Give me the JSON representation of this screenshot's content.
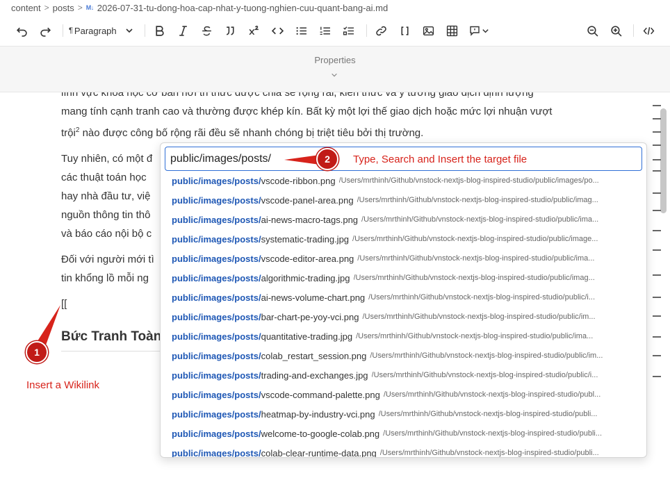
{
  "breadcrumb": {
    "items": [
      "content",
      "posts"
    ],
    "md_badge": "M↓",
    "file": "2026-07-31-tu-dong-hoa-cap-nhat-y-tuong-nghien-cuu-quant-bang-ai.md"
  },
  "toolbar": {
    "paragraph_label": "Paragraph"
  },
  "properties": {
    "label": "Properties"
  },
  "document": {
    "para1_l1": "lĩnh vực khoa học cơ bản nơi tri thức được chia sẻ rộng rãi, kiến thức và ý tưởng giao dịch định lượng",
    "para1_l2": "mang tính cạnh tranh cao và thường được khép kín. Bất kỳ một lợi thế giao dịch hoặc mức lợi nhuận vượt",
    "para1_l3a": "trội",
    "para1_sup": "2",
    "para1_l3b": " nào được công bố rộng rãi đều sẽ nhanh chóng bị triệt tiêu bởi thị trường.",
    "para2_l1": "Tuy nhiên, có một đ",
    "para2_l2": "các thuật toán học",
    "para2_l3": "hay nhà đầu tư, việ",
    "para2_l4": "nguồn thông tin thô",
    "para2_l5": "và báo cáo nội bộ c",
    "para3_l1": "Đối với người mới tì",
    "para3_l2": "tin khổng lồ mỗi ng",
    "wikilink": "[[",
    "heading": "Bức Tranh Toàn"
  },
  "popup": {
    "search_value": "public/images/posts/",
    "query": "public/images/posts/",
    "results": [
      {
        "file": "vscode-ribbon.png",
        "path": "/Users/mrthinh/Github/vnstock-nextjs-blog-inspired-studio/public/images/po..."
      },
      {
        "file": "vscode-panel-area.png",
        "path": "/Users/mrthinh/Github/vnstock-nextjs-blog-inspired-studio/public/imag..."
      },
      {
        "file": "ai-news-macro-tags.png",
        "path": "/Users/mrthinh/Github/vnstock-nextjs-blog-inspired-studio/public/ima..."
      },
      {
        "file": "systematic-trading.jpg",
        "path": "/Users/mrthinh/Github/vnstock-nextjs-blog-inspired-studio/public/image..."
      },
      {
        "file": "vscode-editor-area.png",
        "path": "/Users/mrthinh/Github/vnstock-nextjs-blog-inspired-studio/public/ima..."
      },
      {
        "file": "algorithmic-trading.jpg",
        "path": "/Users/mrthinh/Github/vnstock-nextjs-blog-inspired-studio/public/imag..."
      },
      {
        "file": "ai-news-volume-chart.png",
        "path": "/Users/mrthinh/Github/vnstock-nextjs-blog-inspired-studio/public/i..."
      },
      {
        "file": "bar-chart-pe-yoy-vci.png",
        "path": "/Users/mrthinh/Github/vnstock-nextjs-blog-inspired-studio/public/im..."
      },
      {
        "file": "quantitative-trading.jpg",
        "path": "/Users/mrthinh/Github/vnstock-nextjs-blog-inspired-studio/public/ima..."
      },
      {
        "file": "colab_restart_session.png",
        "path": "/Users/mrthinh/Github/vnstock-nextjs-blog-inspired-studio/public/im..."
      },
      {
        "file": "trading-and-exchanges.jpg",
        "path": "/Users/mrthinh/Github/vnstock-nextjs-blog-inspired-studio/public/i..."
      },
      {
        "file": "vscode-command-palette.png",
        "path": "/Users/mrthinh/Github/vnstock-nextjs-blog-inspired-studio/publ..."
      },
      {
        "file": "heatmap-by-industry-vci.png",
        "path": "/Users/mrthinh/Github/vnstock-nextjs-blog-inspired-studio/publi..."
      },
      {
        "file": "welcome-to-google-colab.png",
        "path": "/Users/mrthinh/Github/vnstock-nextjs-blog-inspired-studio/publi..."
      },
      {
        "file": "colab-clear-runtime-data.png",
        "path": "/Users/mrthinh/Github/vnstock-nextjs-blog-inspired-studio/publi..."
      }
    ]
  },
  "annotations": {
    "badge1": "1",
    "badge2": "2",
    "text1": "Insert a Wikilink",
    "text2": "Type, Search and Insert the target file",
    "color": "#d7231b"
  }
}
